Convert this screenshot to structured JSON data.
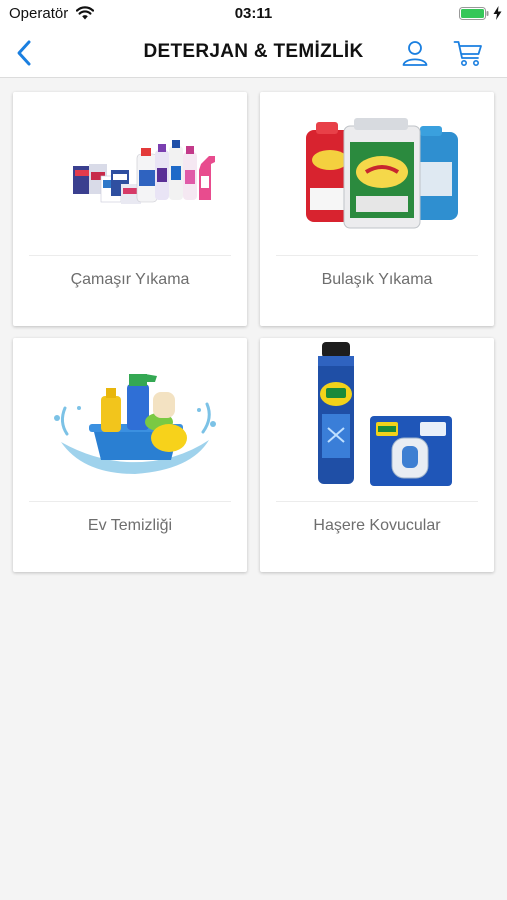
{
  "status_bar": {
    "carrier": "Operatör",
    "time": "03:11"
  },
  "nav": {
    "title": "DETERJAN & TEMİZLİK",
    "accent_color": "#1a7fe0"
  },
  "categories": [
    {
      "label": "Çamaşır Yıkama",
      "image": "laundry-products-image"
    },
    {
      "label": "Bulaşık Yıkama",
      "image": "dishwashing-products-image"
    },
    {
      "label": "Ev Temizliği",
      "image": "home-cleaning-image"
    },
    {
      "label": "Haşere Kovucular",
      "image": "insect-repellent-image"
    }
  ]
}
